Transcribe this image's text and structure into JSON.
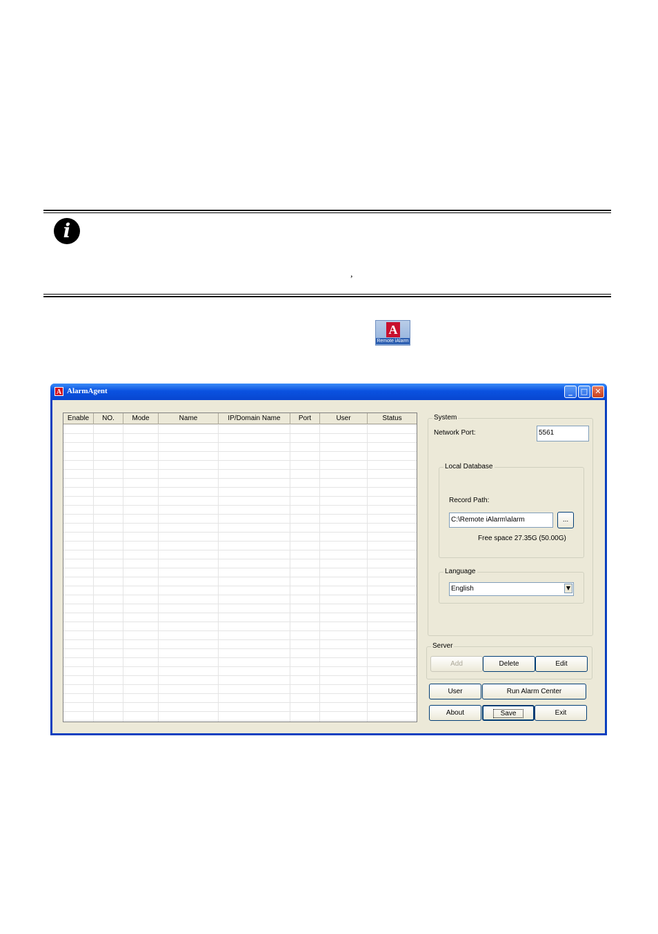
{
  "doc": {
    "comma": ","
  },
  "desktop_icon": {
    "caption": "Remote iAlarm"
  },
  "window": {
    "title": "AlarmAgent",
    "controls": {
      "minimize": "_",
      "maximize": "□",
      "close": "✕"
    },
    "table": {
      "columns": [
        "Enable",
        "NO.",
        "Mode",
        "Name",
        "IP/Domain Name",
        "Port",
        "User",
        "Status"
      ],
      "rows": []
    },
    "system": {
      "group_label": "System",
      "network_port_label": "Network Port:",
      "network_port_value": "5561",
      "local_db": {
        "group_label": "Local Database",
        "record_path_label": "Record Path:",
        "record_path_value": "C:\\Remote iAlarm\\alarm",
        "browse_label": "...",
        "free_space": "Free space 27.35G (50.00G)"
      },
      "language": {
        "group_label": "Language",
        "selected": "English",
        "arrow": "▼"
      }
    },
    "server": {
      "group_label": "Server",
      "add": "Add",
      "delete": "Delete",
      "edit": "Edit"
    },
    "buttons": {
      "user": "User",
      "run_alarm_center": "Run Alarm Center",
      "about": "About",
      "save": "Save",
      "exit": "Exit"
    }
  }
}
